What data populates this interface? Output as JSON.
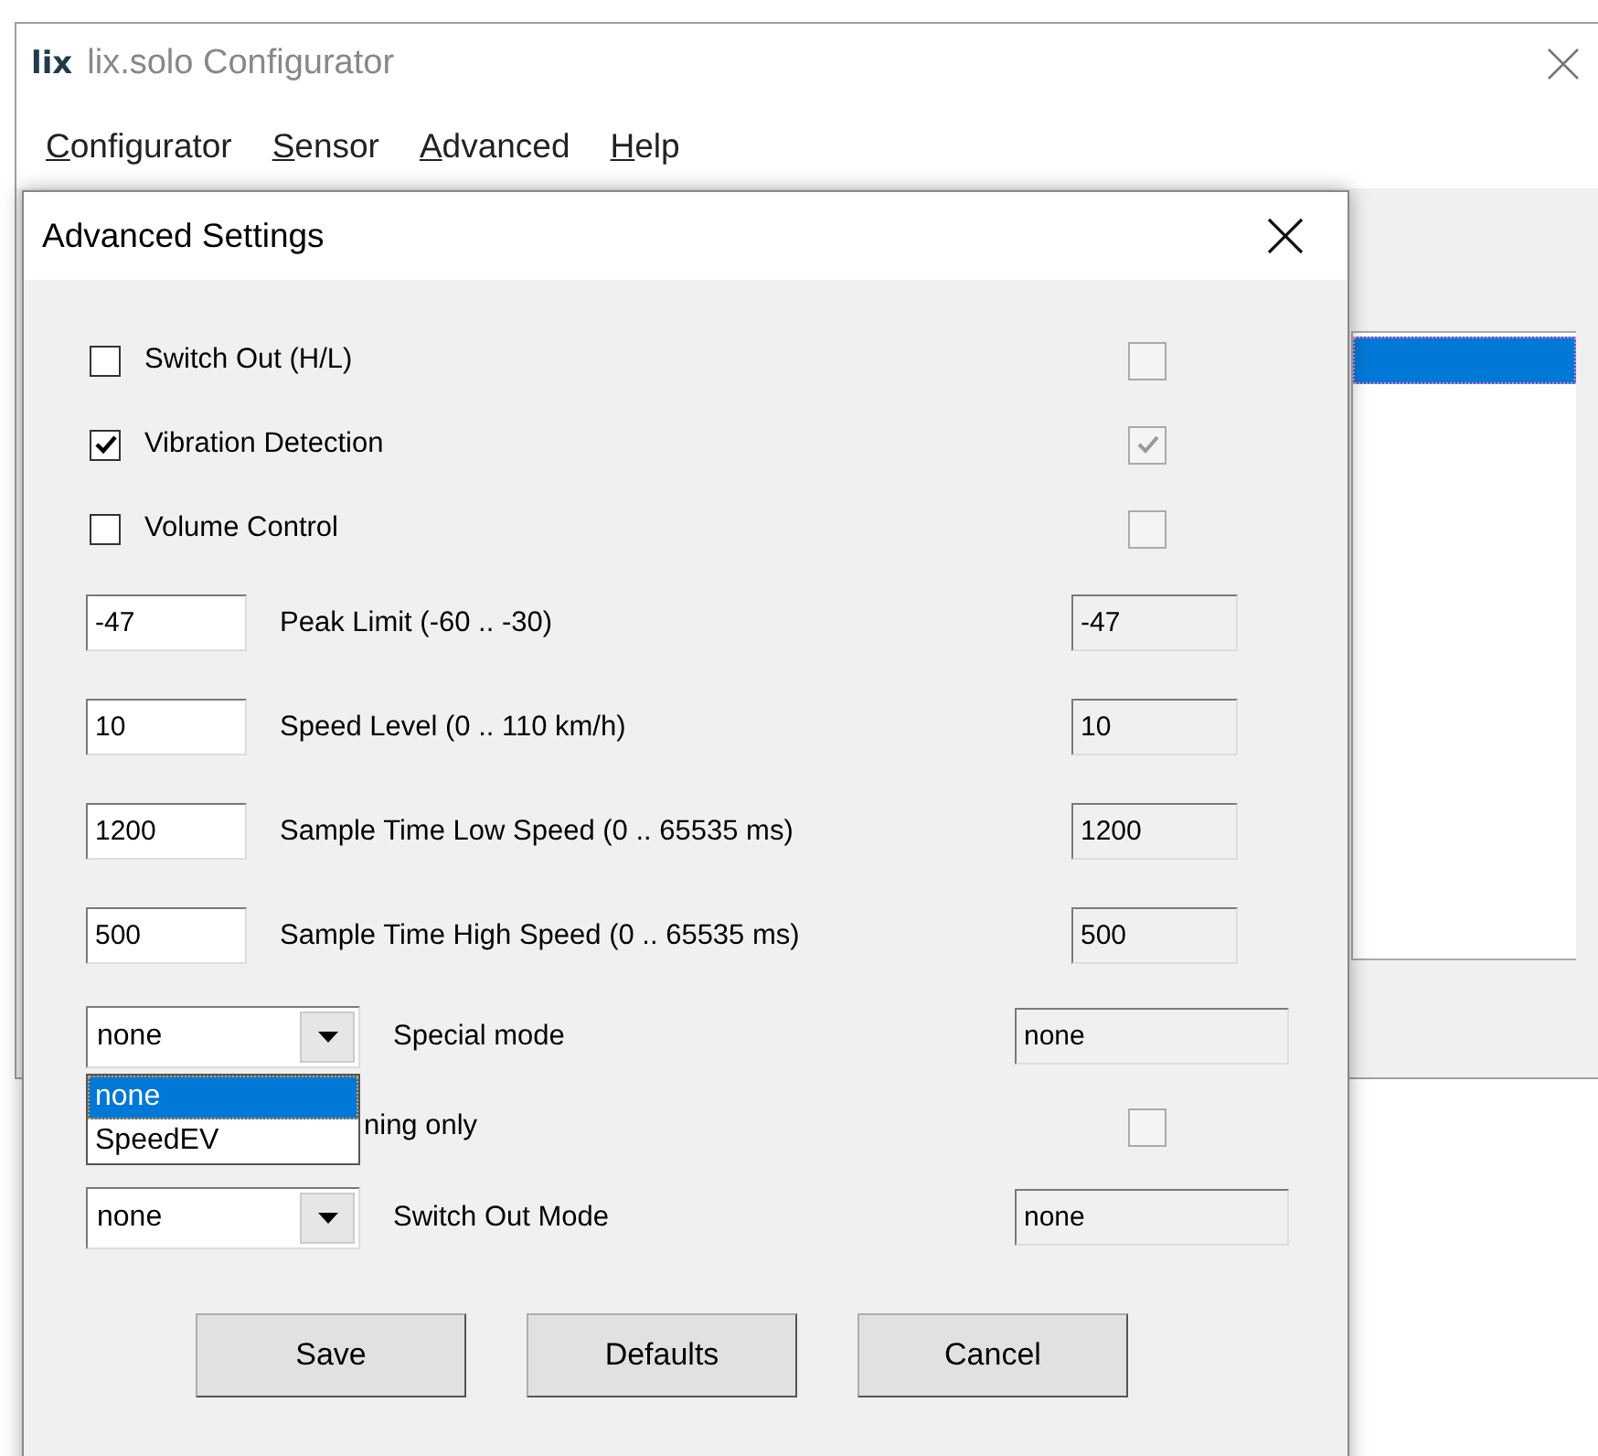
{
  "window": {
    "title": "lix.solo Configurator",
    "logo": "lix"
  },
  "menu": [
    {
      "label": "Configurator"
    },
    {
      "label": "Sensor"
    },
    {
      "label": "Advanced"
    },
    {
      "label": "Help"
    }
  ],
  "dialog": {
    "title": "Advanced Settings",
    "groups": [
      {
        "kind": "checkbox",
        "items": [
          {
            "label": "Switch Out (H/L)",
            "checked": false,
            "current_checked": false
          },
          {
            "label": "Vibration Detection",
            "checked": true,
            "current_checked": true
          },
          {
            "label": "Volume Control",
            "checked": false,
            "current_checked": false
          }
        ]
      },
      {
        "kind": "field",
        "items": [
          {
            "label": "Peak Limit (-60 .. -30)",
            "value": "-47",
            "current": "-47"
          },
          {
            "label": "Speed Level (0 .. 110 km/h)",
            "value": "10",
            "current": "10"
          },
          {
            "label": "Sample Time Low Speed (0 .. 65535 ms)",
            "value": "1200",
            "current": "1200"
          },
          {
            "label": "Sample Time High Speed (0 .. 65535 ms)",
            "value": "500",
            "current": "500"
          }
        ]
      },
      {
        "kind": "combo",
        "items": [
          {
            "label": "Special mode",
            "value": "none",
            "current": "none",
            "options": [
              {
                "label": "none",
                "selected": true
              },
              {
                "label": "SpeedEV",
                "selected": false
              }
            ]
          }
        ]
      },
      {
        "kind": "checkbox",
        "items": [
          {
            "label": "ning only",
            "current_checked": false
          }
        ]
      },
      {
        "kind": "combo",
        "items": [
          {
            "label": "Switch Out Mode",
            "value": "none",
            "current": "none"
          }
        ]
      }
    ],
    "buttons": [
      "Save",
      "Defaults",
      "Cancel"
    ]
  }
}
